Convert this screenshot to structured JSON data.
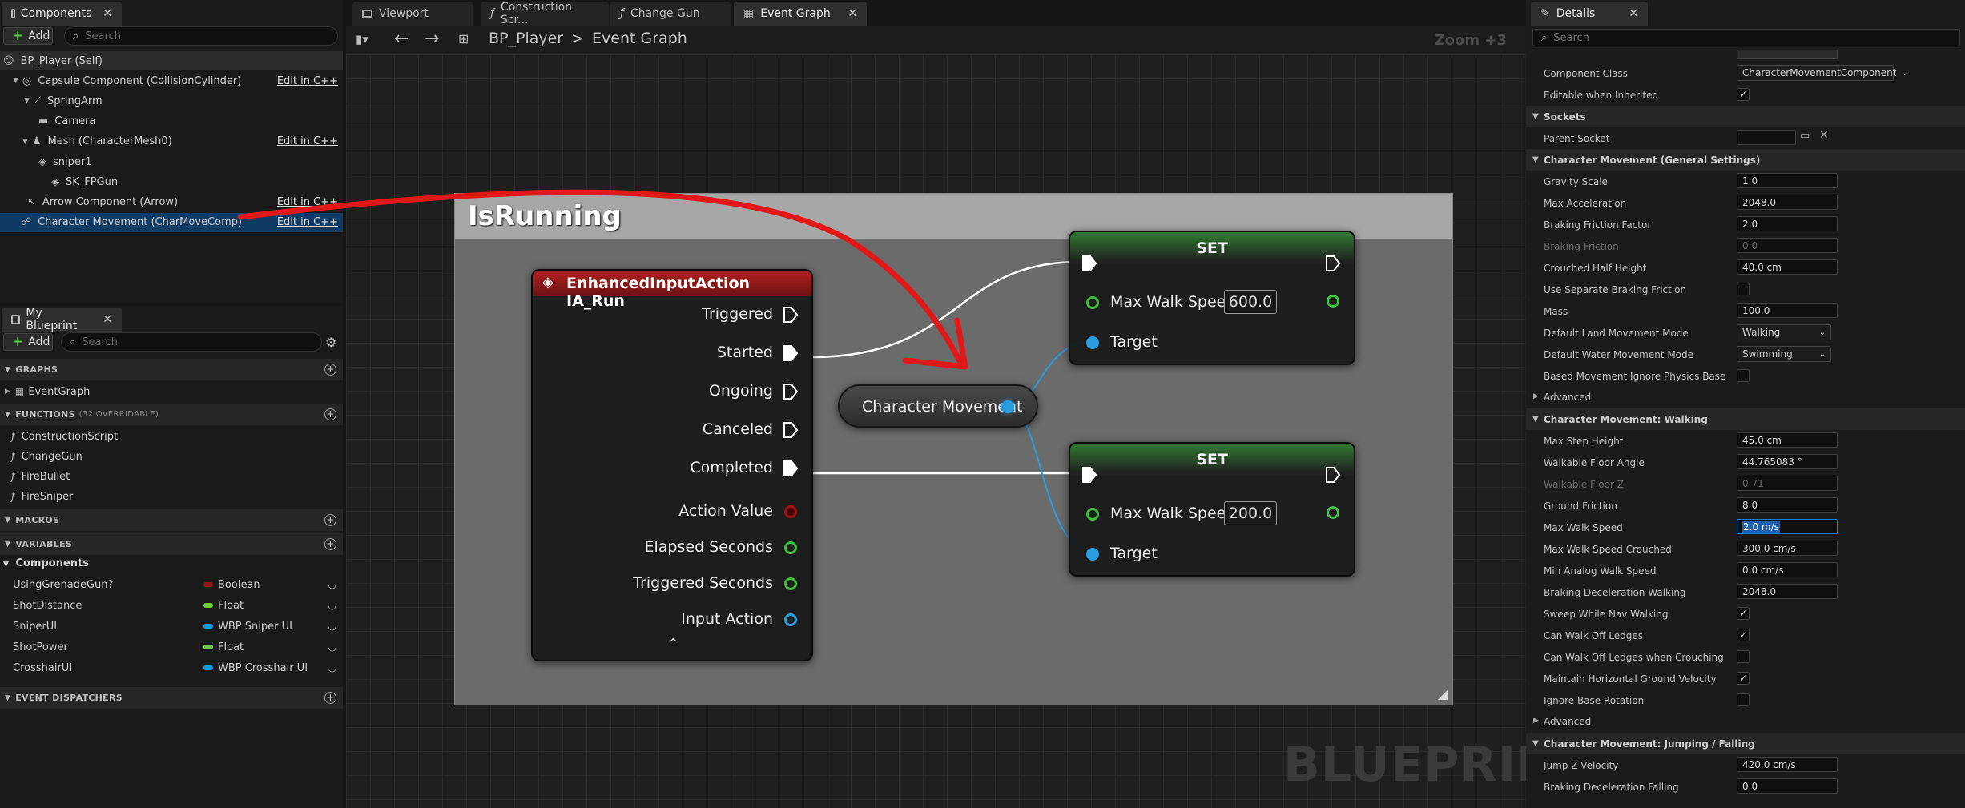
{
  "components_panel": {
    "tab_label": "Components",
    "add_label": "Add",
    "search_placeholder": "Search",
    "tree": [
      {
        "label": "BP_Player (Self)",
        "edit": ""
      },
      {
        "label": "Capsule Component (CollisionCylinder)",
        "edit": "Edit in C++"
      },
      {
        "label": "SpringArm",
        "edit": ""
      },
      {
        "label": "Camera",
        "edit": ""
      },
      {
        "label": "Mesh (CharacterMesh0)",
        "edit": "Edit in C++"
      },
      {
        "label": "sniper1",
        "edit": ""
      },
      {
        "label": "SK_FPGun",
        "edit": ""
      },
      {
        "label": "Arrow Component (Arrow)",
        "edit": "Edit in C++"
      },
      {
        "label": "Character Movement (CharMoveComp)",
        "edit": "Edit in C++"
      }
    ]
  },
  "my_blueprint": {
    "tab_label": "My Blueprint",
    "add_label": "Add",
    "search_placeholder": "Search",
    "graphs_header": "GRAPHS",
    "graphs": [
      "EventGraph"
    ],
    "functions_header": "FUNCTIONS",
    "functions_note": "(32 OVERRIDABLE)",
    "functions": [
      "ConstructionScript",
      "ChangeGun",
      "FireBullet",
      "FireSniper"
    ],
    "macros_header": "MACROS",
    "variables_header": "VARIABLES",
    "variables_category": "Components",
    "variables": [
      {
        "name": "UsingGrenadeGun?",
        "type": "Boolean",
        "color": "#8c1a1a"
      },
      {
        "name": "ShotDistance",
        "type": "Float",
        "color": "#6fd13a"
      },
      {
        "name": "SniperUI",
        "type": "WBP Sniper UI",
        "color": "#1b9be0"
      },
      {
        "name": "ShotPower",
        "type": "Float",
        "color": "#6fd13a"
      },
      {
        "name": "CrosshairUI",
        "type": "WBP Crosshair UI",
        "color": "#1b9be0"
      }
    ],
    "dispatchers_header": "EVENT DISPATCHERS"
  },
  "editor_tabs": [
    {
      "label": "Viewport",
      "icon": "viewport-icon"
    },
    {
      "label": "Construction Scr...",
      "icon": "function-icon"
    },
    {
      "label": "Change Gun",
      "icon": "function-icon"
    },
    {
      "label": "Event Graph",
      "icon": "graph-icon"
    }
  ],
  "breadcrumb": {
    "root": "BP_Player",
    "separator": ">",
    "current": "Event Graph"
  },
  "zoom_label": "Zoom +3",
  "watermark": "BLUEPRINT",
  "graph": {
    "comment_title": "IsRunning",
    "input_node": {
      "title": "EnhancedInputAction IA_Run",
      "exec_pins": [
        "Triggered",
        "Started",
        "Ongoing",
        "Canceled",
        "Completed"
      ],
      "data_pins": [
        {
          "label": "Action Value",
          "color": "#a01212"
        },
        {
          "label": "Elapsed Seconds",
          "color": "#3fbf3f"
        },
        {
          "label": "Triggered Seconds",
          "color": "#3fbf3f"
        },
        {
          "label": "Input Action",
          "color": "#2a9de0"
        }
      ]
    },
    "character_movement_label": "Character Movement",
    "set_nodes": [
      {
        "title": "SET",
        "prop": "Max Walk Speed",
        "value": "600.0",
        "target": "Target"
      },
      {
        "title": "SET",
        "prop": "Max Walk Speed",
        "value": "200.0",
        "target": "Target"
      }
    ]
  },
  "details": {
    "tab_label": "Details",
    "search_placeholder": "Search",
    "rows": [
      {
        "kind": "row",
        "label": "Component Class",
        "dropdown": "CharacterMovementComponent"
      },
      {
        "kind": "row",
        "label": "Editable when Inherited",
        "check": true
      },
      {
        "kind": "section",
        "label": "Sockets"
      },
      {
        "kind": "row",
        "label": "Parent Socket",
        "socket": true
      },
      {
        "kind": "section",
        "label": "Character Movement (General Settings)"
      },
      {
        "kind": "row",
        "label": "Gravity Scale",
        "value": "1.0"
      },
      {
        "kind": "row",
        "label": "Max Acceleration",
        "value": "2048.0"
      },
      {
        "kind": "row",
        "label": "Braking Friction Factor",
        "value": "2.0"
      },
      {
        "kind": "row",
        "label": "Braking Friction",
        "value": "0.0",
        "dim": true
      },
      {
        "kind": "row",
        "label": "Crouched Half Height",
        "value": "40.0 cm"
      },
      {
        "kind": "row",
        "label": "Use Separate Braking Friction",
        "check": false
      },
      {
        "kind": "row",
        "label": "Mass",
        "value": "100.0"
      },
      {
        "kind": "row",
        "label": "Default Land Movement Mode",
        "dropdown": "Walking"
      },
      {
        "kind": "row",
        "label": "Default Water Movement Mode",
        "dropdown": "Swimming"
      },
      {
        "kind": "row",
        "label": "Based Movement Ignore Physics Base",
        "check": false
      },
      {
        "kind": "sub",
        "label": "Advanced"
      },
      {
        "kind": "section",
        "label": "Character Movement: Walking"
      },
      {
        "kind": "row",
        "label": "Max Step Height",
        "value": "45.0 cm"
      },
      {
        "kind": "row",
        "label": "Walkable Floor Angle",
        "value": "44.765083 °"
      },
      {
        "kind": "row",
        "label": "Walkable Floor Z",
        "value": "0.71",
        "dim": true
      },
      {
        "kind": "row",
        "label": "Ground Friction",
        "value": "8.0"
      },
      {
        "kind": "row",
        "label": "Max Walk Speed",
        "value": "2.0 m/s",
        "selected": true
      },
      {
        "kind": "row",
        "label": "Max Walk Speed Crouched",
        "value": "300.0 cm/s"
      },
      {
        "kind": "row",
        "label": "Min Analog Walk Speed",
        "value": "0.0 cm/s"
      },
      {
        "kind": "row",
        "label": "Braking Deceleration Walking",
        "value": "2048.0"
      },
      {
        "kind": "row",
        "label": "Sweep While Nav Walking",
        "check": true
      },
      {
        "kind": "row",
        "label": "Can Walk Off Ledges",
        "check": true
      },
      {
        "kind": "row",
        "label": "Can Walk Off Ledges when Crouching",
        "check": false
      },
      {
        "kind": "row",
        "label": "Maintain Horizontal Ground Velocity",
        "check": true
      },
      {
        "kind": "row",
        "label": "Ignore Base Rotation",
        "check": false
      },
      {
        "kind": "sub",
        "label": "Advanced"
      },
      {
        "kind": "section",
        "label": "Character Movement: Jumping / Falling"
      },
      {
        "kind": "row",
        "label": "Jump Z Velocity",
        "value": "420.0 cm/s"
      },
      {
        "kind": "row",
        "label": "Braking Deceleration Falling",
        "value": "0.0"
      }
    ]
  }
}
